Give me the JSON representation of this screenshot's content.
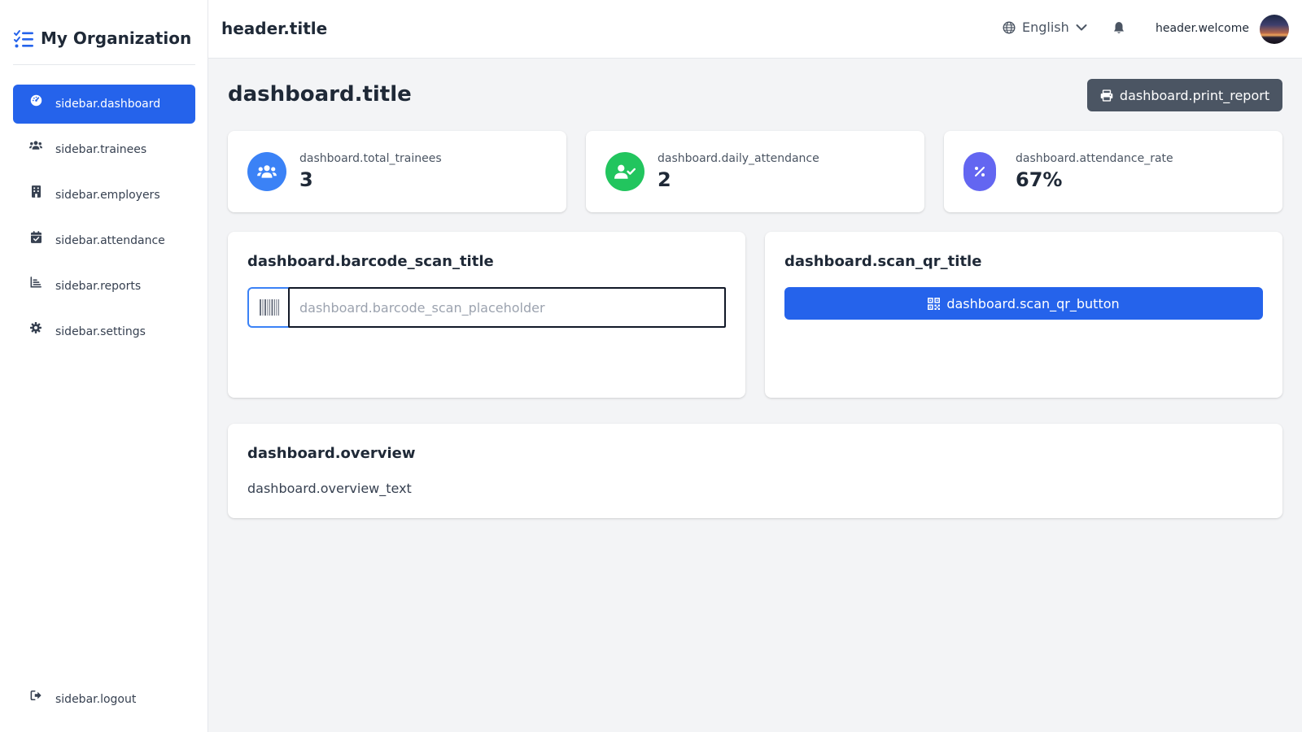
{
  "sidebar": {
    "brand": "My Organization",
    "items": [
      {
        "label": "sidebar.dashboard",
        "icon": "gauge-icon",
        "active": true
      },
      {
        "label": "sidebar.trainees",
        "icon": "users-icon"
      },
      {
        "label": "sidebar.employers",
        "icon": "building-icon"
      },
      {
        "label": "sidebar.attendance",
        "icon": "calendar-check-icon"
      },
      {
        "label": "sidebar.reports",
        "icon": "chart-icon"
      },
      {
        "label": "sidebar.settings",
        "icon": "gear-icon"
      }
    ],
    "logout": "sidebar.logout"
  },
  "header": {
    "title": "header.title",
    "language": "English",
    "welcome": "header.welcome"
  },
  "dashboard": {
    "title": "dashboard.title",
    "print_report": "dashboard.print_report",
    "stats": [
      {
        "label": "dashboard.total_trainees",
        "value": "3",
        "color": "#3b82f6",
        "icon": "users-icon"
      },
      {
        "label": "dashboard.daily_attendance",
        "value": "2",
        "color": "#22c55e",
        "icon": "user-check-icon"
      },
      {
        "label": "dashboard.attendance_rate",
        "value": "67%",
        "color": "#6366f1",
        "icon": "percent-icon"
      }
    ],
    "barcode_scan_title": "dashboard.barcode_scan_title",
    "barcode_scan_placeholder": "dashboard.barcode_scan_placeholder",
    "scan_qr_title": "dashboard.scan_qr_title",
    "scan_qr_button": "dashboard.scan_qr_button",
    "overview": "dashboard.overview",
    "overview_text": "dashboard.overview_text"
  },
  "colors": {
    "primary": "#2563eb",
    "secondary_button": "#4b5563",
    "background": "#f3f4f6"
  }
}
